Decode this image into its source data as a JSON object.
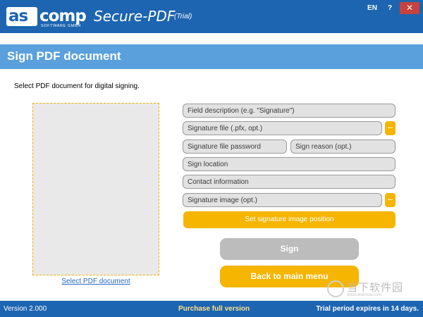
{
  "titlebar": {
    "logo_brand": "as",
    "logo_brand_rest": "comp",
    "logo_sub": "SOFTWARE GMBH",
    "app_name": "Secure-PDF",
    "app_trial": "(Trial)",
    "lang_button": "EN",
    "help_button": "?",
    "close_button": "✕"
  },
  "header": {
    "title": "Sign PDF document"
  },
  "instruction": "Select PDF document for digital signing.",
  "drop_area": {
    "link_label": "Select PDF document"
  },
  "form": {
    "field_description": "Field description (e.g. \"Signature\")",
    "signature_file": "Signature file (.pfx, opt.)",
    "signature_password": "Signature file password",
    "sign_reason": "Sign reason (opt.)",
    "sign_location": "Sign location",
    "contact_info": "Contact information",
    "signature_image": "Signature image (opt.)",
    "browse_label": "...",
    "set_position_label": "Set signature image position"
  },
  "actions": {
    "sign_label": "Sign",
    "back_label": "Back to main menu"
  },
  "watermark": {
    "text": "当下软件园",
    "url": "www.downxia.com"
  },
  "statusbar": {
    "version": "Version 2.000",
    "purchase": "Purchase full version",
    "trial": "Trial period expires in 14 days."
  },
  "colors": {
    "primary_blue": "#1d65b0",
    "header_blue": "#5aa0dd",
    "accent_yellow": "#f5b500",
    "disabled_gray": "#bcbcbc",
    "field_gray": "#e2e2e2"
  }
}
